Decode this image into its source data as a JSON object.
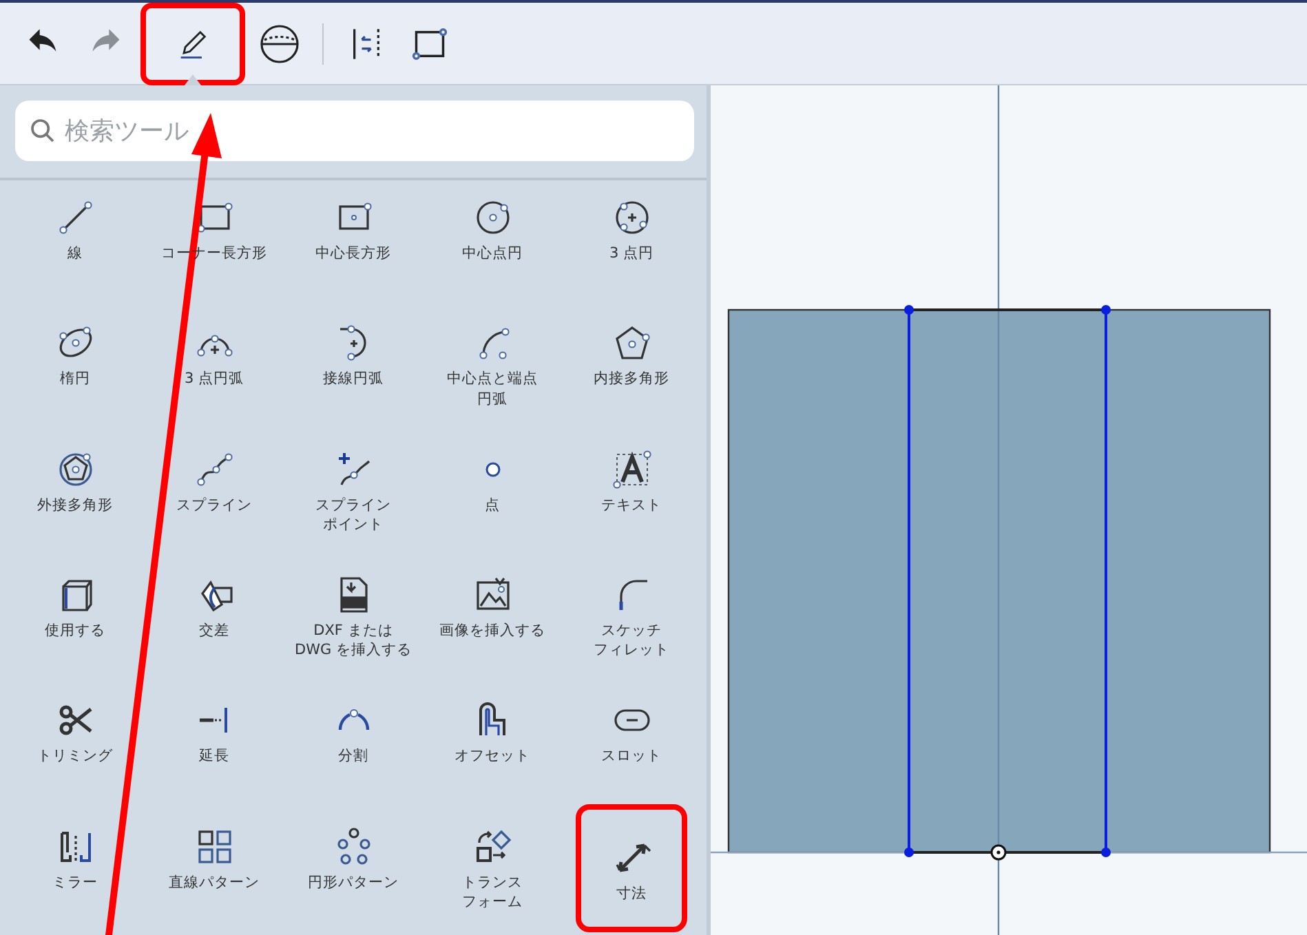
{
  "toolbar": {
    "buttons": [
      {
        "selected": false,
        "disabled": false,
        "annotated": false
      },
      {
        "selected": false,
        "disabled": true,
        "annotated": false
      },
      {
        "selected": true,
        "disabled": false,
        "annotated": true
      },
      {
        "selected": false,
        "disabled": false,
        "annotated": false
      },
      {
        "selected": false,
        "disabled": false,
        "annotated": false
      },
      {
        "selected": false,
        "disabled": false,
        "annotated": false
      }
    ]
  },
  "search": {
    "placeholder": "検索ツール"
  },
  "tools": [
    {
      "label": "線",
      "annotated": false
    },
    {
      "label": "コーナー長方形",
      "annotated": false
    },
    {
      "label": "中心長方形",
      "annotated": false
    },
    {
      "label": "中心点円",
      "annotated": false
    },
    {
      "label": "3 点円",
      "annotated": false
    },
    {
      "label": "楕円",
      "annotated": false
    },
    {
      "label": "3 点円弧",
      "annotated": false
    },
    {
      "label": "接線円弧",
      "annotated": false
    },
    {
      "label": [
        "中心点と端点",
        "円弧"
      ],
      "annotated": false
    },
    {
      "label": "内接多角形",
      "annotated": false
    },
    {
      "label": "外接多角形",
      "annotated": false
    },
    {
      "label": "スプライン",
      "annotated": false
    },
    {
      "label": [
        "スプライン",
        "ポイント"
      ],
      "annotated": false
    },
    {
      "label": "点",
      "annotated": false
    },
    {
      "label": "テキスト",
      "annotated": false
    },
    {
      "label": "使用する",
      "annotated": false
    },
    {
      "label": "交差",
      "annotated": false
    },
    {
      "label": [
        "DXF または",
        "DWG を挿入する"
      ],
      "annotated": false
    },
    {
      "label": "画像を挿入する",
      "annotated": false
    },
    {
      "label": [
        "スケッチ",
        "フィレット"
      ],
      "annotated": false
    },
    {
      "label": "トリミング",
      "annotated": false
    },
    {
      "label": "延長",
      "annotated": false
    },
    {
      "label": "分割",
      "annotated": false
    },
    {
      "label": "オフセット",
      "annotated": false
    },
    {
      "label": "スロット",
      "annotated": false
    },
    {
      "label": "ミラー",
      "annotated": false
    },
    {
      "label": "直線パターン",
      "annotated": false
    },
    {
      "label": "円形パターン",
      "annotated": false
    },
    {
      "label": [
        "トランス",
        "フォーム"
      ],
      "annotated": false
    },
    {
      "label": "寸法",
      "annotated": true
    }
  ]
}
